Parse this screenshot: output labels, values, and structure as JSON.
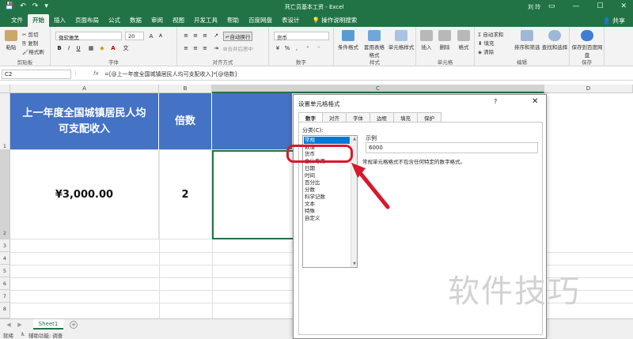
{
  "titlebar": {
    "quick_access": [
      "💾",
      "↶",
      "↷",
      "▾"
    ],
    "doc_title": "死亡员基本工资 - Excel",
    "user": "刘 玲",
    "win_buttons": [
      "▭",
      "—",
      "☐",
      "✕"
    ]
  },
  "tabs": [
    "文件",
    "开始",
    "插入",
    "页面布局",
    "公式",
    "数据",
    "审阅",
    "视图",
    "开发工具",
    "帮助",
    "百度网盘",
    "表设计"
  ],
  "tell_me": "操作说明搜索",
  "share": "共享",
  "ribbon": {
    "clipboard": {
      "paste": "粘贴",
      "cut": "剪切",
      "copy": "复制",
      "format_painter": "格式刷",
      "label": "剪贴板"
    },
    "font": {
      "name": "微软雅黑",
      "size": "20",
      "bold": "B",
      "italic": "I",
      "underline": "U",
      "wen": "文",
      "label": "字体"
    },
    "alignment": {
      "wrap": "自动换行",
      "merge": "合并后居中",
      "label": "对齐方式"
    },
    "number": {
      "format": "货币",
      "label": "数字"
    },
    "styles": {
      "conditional": "条件格式",
      "table": "套用表格格式",
      "cell_styles": "单元格样式",
      "label": "样式"
    },
    "cells": {
      "insert": "插入",
      "delete": "删除",
      "format": "格式",
      "label": "单元格"
    },
    "editing": {
      "autosum": "自动求和",
      "fill": "填充",
      "clear": "清除",
      "sort": "排序和筛选",
      "find": "查找和选择",
      "label": "编辑"
    },
    "save": {
      "save_baidu": "保存到百度网盘",
      "label": "保存"
    }
  },
  "formula_bar": {
    "name_box": "C2",
    "fx": "fx",
    "formula": "=[@上一年度全国城镇居民人均可支配收入]*[@倍数]"
  },
  "columns": [
    "A",
    "B",
    "C",
    "D"
  ],
  "rows": [
    "1",
    "2",
    "3",
    "4",
    "5",
    "6",
    "7",
    "8"
  ],
  "cells": {
    "a1": "上一年度全国城镇居民人均可支配收入",
    "b1": "倍数",
    "a2": "¥3,000.00",
    "b2": "2"
  },
  "sheet_tab": "Sheet1",
  "status": {
    "ready": "就绪",
    "accessibility": "辅助功能: 调查"
  },
  "dialog": {
    "title": "设置单元格格式",
    "help": "?",
    "close": "✕",
    "tabs": [
      "数字",
      "对齐",
      "字体",
      "边框",
      "填充",
      "保护"
    ],
    "category_label": "分类(C):",
    "categories": [
      "常规",
      "数值",
      "货币",
      "会计专用",
      "日期",
      "时间",
      "百分比",
      "分数",
      "科学记数",
      "文本",
      "特殊",
      "自定义"
    ],
    "selected_category": "常规",
    "sample_label": "示例",
    "sample_value": "6000",
    "description": "常规单元格格式不包含任何特定的数字格式。"
  },
  "watermark": "软件技巧",
  "colors": {
    "excel_green": "#217346",
    "header_blue": "#4472c4",
    "callout_red": "#d8182c"
  }
}
